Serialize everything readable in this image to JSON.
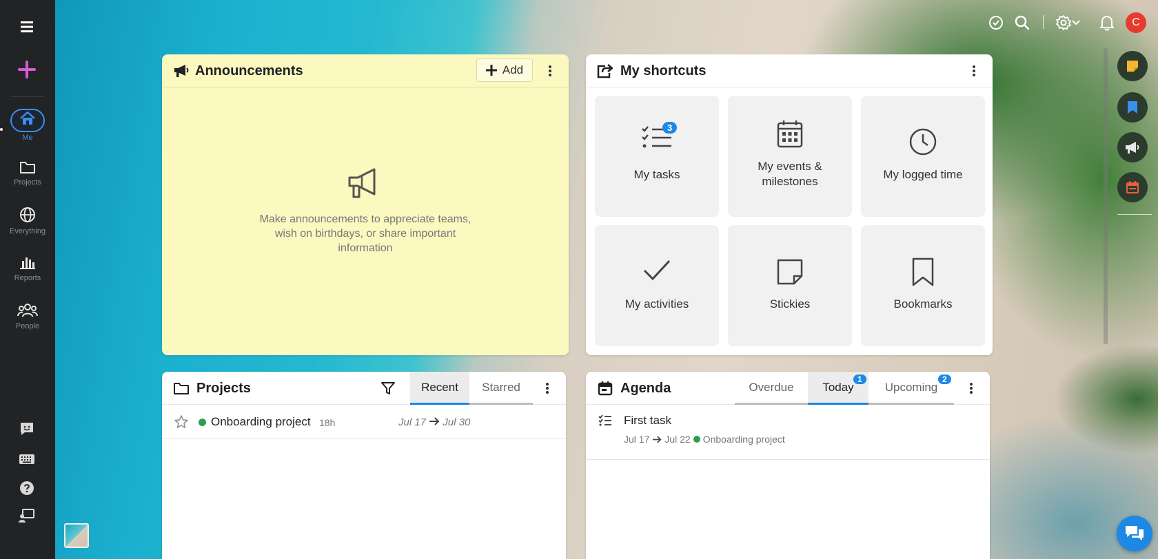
{
  "nav": {
    "items": [
      {
        "label": "Me",
        "icon": "home-icon"
      },
      {
        "label": "Projects",
        "icon": "folder-icon"
      },
      {
        "label": "Everything",
        "icon": "globe-icon"
      },
      {
        "label": "Reports",
        "icon": "bar-chart-icon"
      },
      {
        "label": "People",
        "icon": "people-icon"
      }
    ]
  },
  "topbar": {
    "avatar_initial": "C"
  },
  "announcements": {
    "title": "Announcements",
    "add_label": "Add",
    "empty_text": "Make announcements to appreciate teams, wish on birthdays, or share important information"
  },
  "shortcuts": {
    "title": "My shortcuts",
    "tiles": [
      {
        "label": "My tasks",
        "icon": "checklist-icon",
        "badge": "3"
      },
      {
        "label": "My events & milestones",
        "icon": "calendar-icon"
      },
      {
        "label": "My logged time",
        "icon": "clock-icon"
      },
      {
        "label": "My activities",
        "icon": "checkmark-icon"
      },
      {
        "label": "Stickies",
        "icon": "sticky-note-icon"
      },
      {
        "label": "Bookmarks",
        "icon": "bookmark-icon"
      }
    ]
  },
  "projects": {
    "title": "Projects",
    "tabs": [
      "Recent",
      "Starred"
    ],
    "active_tab": "Recent",
    "rows": [
      {
        "name": "Onboarding project",
        "age": "18h",
        "start": "Jul 17",
        "end": "Jul 30",
        "status_color": "#2e9e4a"
      }
    ]
  },
  "agenda": {
    "title": "Agenda",
    "tabs": [
      {
        "label": "Overdue",
        "badge": ""
      },
      {
        "label": "Today",
        "badge": "1"
      },
      {
        "label": "Upcoming",
        "badge": "2"
      }
    ],
    "active_tab": "Today",
    "items": [
      {
        "title": "First task",
        "start": "Jul 17",
        "end": "Jul 22",
        "project": "Onboarding project"
      }
    ]
  },
  "colors": {
    "accent": "#1e88e5",
    "nav_bg": "#212325",
    "announce_bg": "#fbf8c0",
    "avatar_bg": "#e63b2e",
    "project_status": "#2e9e4a"
  }
}
